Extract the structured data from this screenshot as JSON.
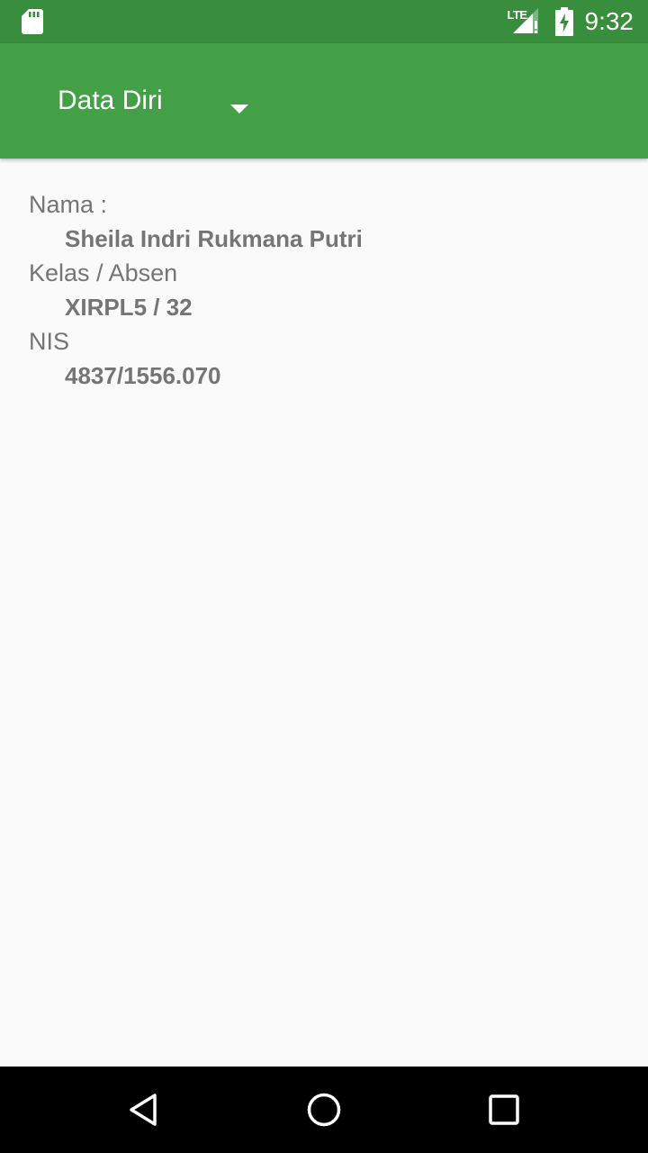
{
  "status_bar": {
    "network": "LTE",
    "time": "9:32",
    "icons": [
      "sd-card-icon",
      "signal-icon",
      "battery-charging-icon"
    ],
    "background": "#388e3c"
  },
  "app_bar": {
    "spinner_selected": "Data Diri",
    "background": "#43a047"
  },
  "profile": {
    "nama_label": "Nama :",
    "nama_value": "Sheila Indri Rukmana Putri",
    "kelas_label": "Kelas / Absen",
    "kelas_value": "XIRPL5 / 32",
    "nis_label": "NIS",
    "nis_value": "4837/1556.070"
  },
  "nav_bar": {
    "buttons": [
      "back-icon",
      "home-icon",
      "recents-icon"
    ]
  }
}
